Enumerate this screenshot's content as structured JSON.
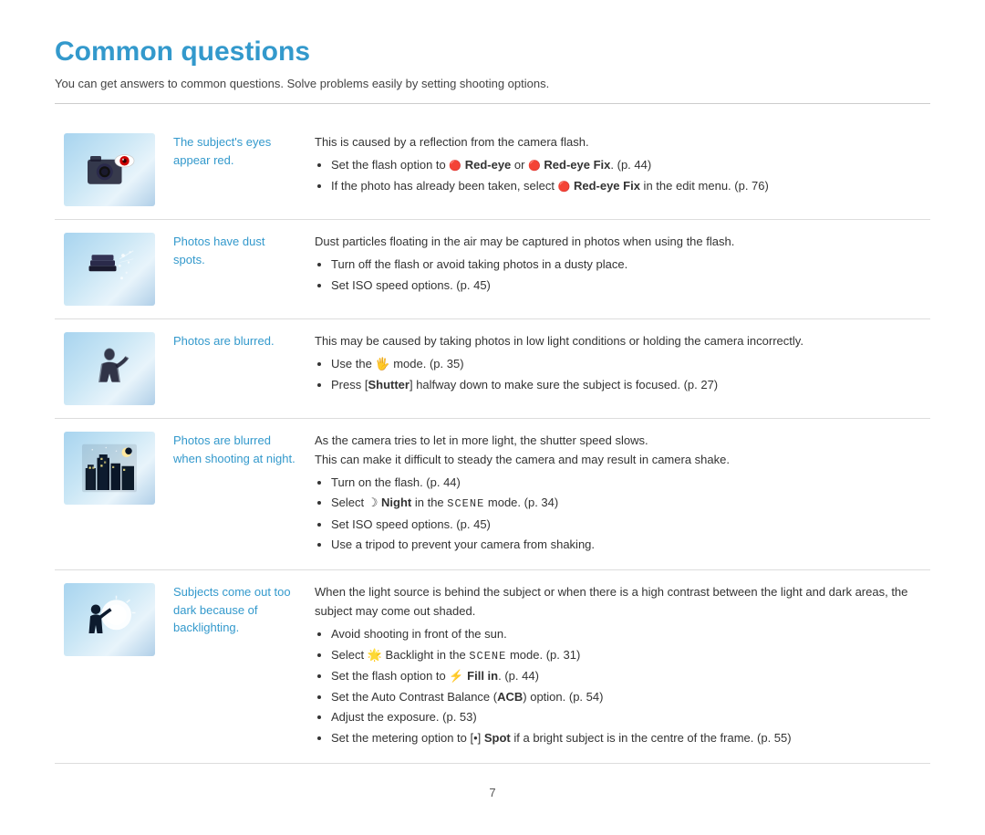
{
  "page": {
    "title": "Common questions",
    "subtitle": "You can get answers to common questions. Solve problems easily by setting shooting options.",
    "page_number": "7"
  },
  "rows": [
    {
      "id": "row-red-eye",
      "label": "The subject's eyes appear red.",
      "content_intro": "This is caused by a reflection from the camera flash.",
      "bullets": [
        "Set the flash option to 🔴 Red-eye or 🔴 Red-eye Fix. (p. 44)",
        "If the photo has already been taken, select 🔴 Red-eye Fix in the edit menu. (p. 76)"
      ],
      "image_type": "red-eye"
    },
    {
      "id": "row-dust",
      "label": "Photos have dust spots.",
      "content_intro": "Dust particles floating in the air may be captured in photos when using the flash.",
      "bullets": [
        "Turn off the flash or avoid taking photos in a dusty place.",
        "Set ISO speed options. (p. 45)"
      ],
      "image_type": "dust"
    },
    {
      "id": "row-blurred",
      "label": "Photos are blurred.",
      "content_intro": "This may be caused by taking photos in low light conditions or holding the camera incorrectly.",
      "bullets": [
        "Use the 🤚 mode. (p. 35)",
        "Press [Shutter] halfway down to make sure the subject is focused. (p. 27)"
      ],
      "image_type": "blurred"
    },
    {
      "id": "row-night",
      "label": "Photos are blurred when shooting at night.",
      "content_intro": "As the camera tries to let in more light, the shutter speed slows.\nThis can make it difficult to steady the camera and may result in camera shake.",
      "bullets": [
        "Turn on the flash. (p. 44)",
        "Select 🌙 Night in the SCENE mode. (p. 34)",
        "Set ISO speed options. (p. 45)",
        "Use a tripod to prevent your camera from shaking."
      ],
      "image_type": "night"
    },
    {
      "id": "row-backlight",
      "label": "Subjects come out too dark because of backlighting.",
      "content_intro": "When the light source is behind the subject or when there is a high contrast between the light and dark areas, the subject may come out shaded.",
      "bullets": [
        "Avoid shooting in front of the sun.",
        "Select 🌟 Backlight in the SCENE mode. (p. 31)",
        "Set the flash option to ⚡ Fill in. (p. 44)",
        "Set the Auto Contrast Balance (ACB) option. (p. 54)",
        "Adjust the exposure. (p. 53)",
        "Set the metering option to [•] Spot if a bright subject is in the centre of the frame. (p. 55)"
      ],
      "image_type": "backlight"
    }
  ]
}
